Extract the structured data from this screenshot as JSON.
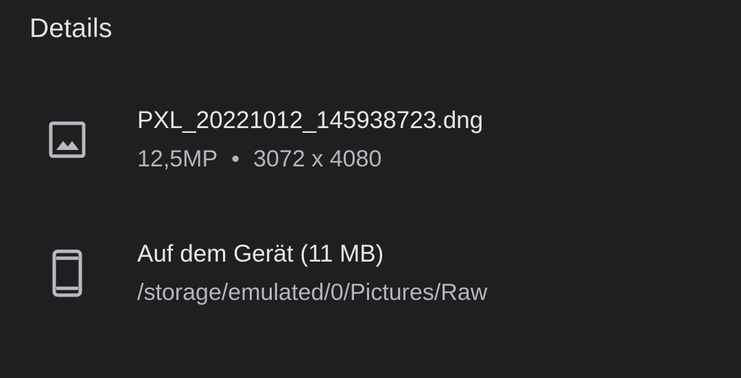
{
  "panel": {
    "title": "Details"
  },
  "file": {
    "icon": "image-icon",
    "name": "PXL_20221012_145938723.dng",
    "megapixels": "12,5MP",
    "separator": "•",
    "dimensions": "3072 x 4080"
  },
  "location": {
    "icon": "phone-icon",
    "label": "Auf dem Gerät (11 MB)",
    "path": "/storage/emulated/0/Pictures/Raw"
  },
  "colors": {
    "background": "#1f1f21",
    "primary_text": "#e8e8eb",
    "secondary_text": "#b5b5ba",
    "icon": "#b9b9be"
  }
}
